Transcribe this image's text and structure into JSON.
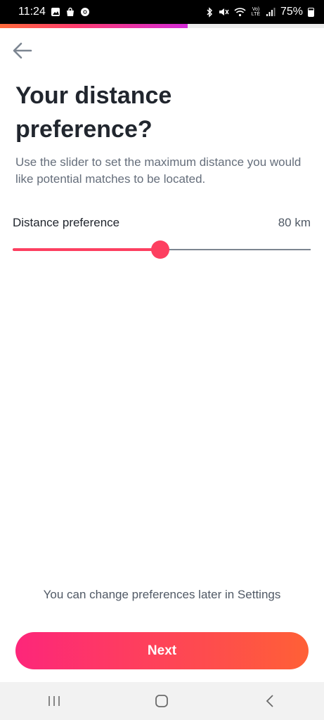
{
  "status_bar": {
    "time": "11:24",
    "battery": "75%",
    "signal_label": "Vo) LTE"
  },
  "progress": {
    "fraction": 0.58
  },
  "page": {
    "title": "Your distance preference?",
    "subtitle": "Use the slider to set the maximum distance you would like potential matches to be located."
  },
  "distance": {
    "label": "Distance preference",
    "value_text": "80 km",
    "value": 80,
    "slider_fraction": 0.495
  },
  "footer": {
    "note": "You can change preferences later in Settings",
    "next_label": "Next"
  },
  "colors": {
    "accent": "#fd3f60",
    "button_gradient_start": "#fd267a",
    "button_gradient_end": "#ff6036"
  },
  "icons": {
    "back": "arrow-left-icon",
    "nav_recents": "recents-icon",
    "nav_home": "home-icon",
    "nav_back": "chevron-left-icon"
  }
}
